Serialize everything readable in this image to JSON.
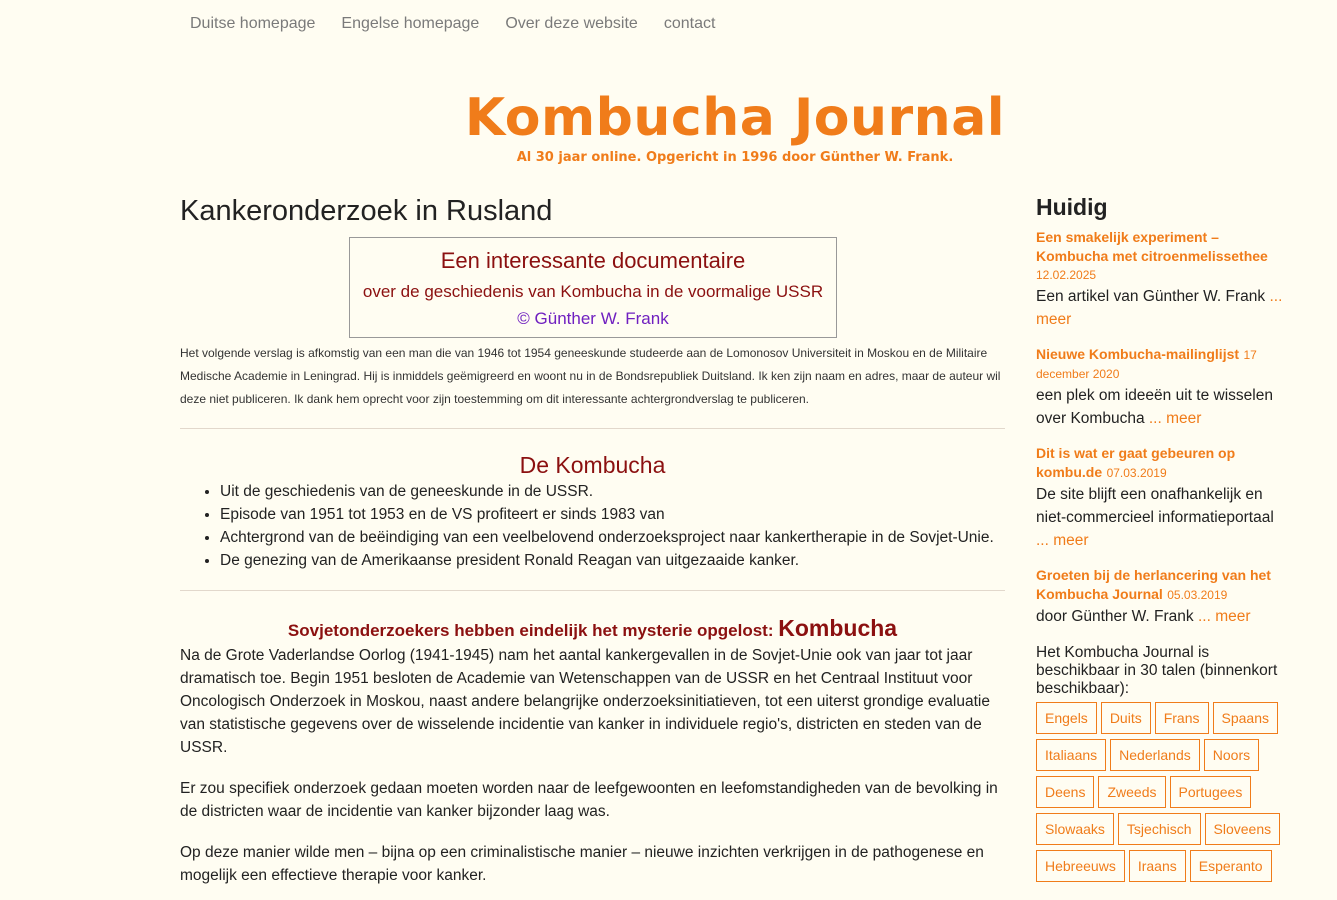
{
  "nav": {
    "items": [
      {
        "label": "Duitse homepage"
      },
      {
        "label": "Engelse homepage"
      },
      {
        "label": "Over deze website"
      },
      {
        "label": "contact"
      }
    ]
  },
  "header": {
    "title": "Kombucha Journal",
    "tagline": "Al 30 jaar online. Opgericht in 1996 door Günther W. Frank."
  },
  "article": {
    "title": "Kankeronderzoek in Rusland",
    "box": {
      "line1": "Een interessante documentaire",
      "line2": "over de geschiedenis van Kombucha in de voormalige USSR",
      "line3": "© Günther W. Frank"
    },
    "intro": "Het volgende verslag is afkomstig van een man die van 1946 tot 1954 geneeskunde studeerde aan de Lomonosov Universiteit in Moskou en de Militaire Medische Academie in Leningrad. Hij is inmiddels geëmigreerd en woont nu in de Bondsrepubliek Duitsland. Ik ken zijn naam en adres, maar de auteur wil deze niet publiceren. Ik dank hem oprecht voor zijn toestemming om dit interessante achtergrondverslag te publiceren.",
    "section1_title": "De Kombucha",
    "points": [
      "Uit de geschiedenis van de geneeskunde in de USSR.",
      "Episode van 1951 tot 1953 en de VS profiteert er sinds 1983 van",
      "Achtergrond van de beëindiging van een veelbelovend onderzoeksproject naar kankertherapie in de Sovjet-Unie.",
      "De genezing van de Amerikaanse president Ronald Reagan van uitgezaaide kanker."
    ],
    "section2_title": "Sovjetonderzoekers hebben eindelijk het mysterie opgelost:",
    "section2_title_bold": "Kombucha",
    "paragraphs": [
      "Na de Grote Vaderlandse Oorlog (1941-1945) nam het aantal kankergevallen in de Sovjet-Unie ook van jaar tot jaar dramatisch toe. Begin 1951 besloten de Academie van Wetenschappen van de USSR en het Centraal Instituut voor Oncologisch Onderzoek in Moskou, naast andere belangrijke onderzoeksinitiatieven, tot een uiterst grondige evaluatie van statistische gegevens over de wisselende incidentie van kanker in individuele regio's, districten en steden van de USSR.",
      "Er zou specifiek onderzoek gedaan moeten worden naar de leefgewoonten en leefomstandigheden van de bevolking in de districten waar de incidentie van kanker bijzonder laag was.",
      "Op deze manier wilde men – bijna op een criminalistische manier – nieuwe inzichten verkrijgen in de pathogenese en mogelijk een effectieve therapie voor kanker."
    ]
  },
  "sidebar": {
    "heading": "Huidig",
    "news": [
      {
        "title": "Een smakelijk experiment – Kombucha met citroenmelissethee",
        "date": "12.02.2025",
        "text": "Een artikel van Günther W. Frank",
        "more": "... meer"
      },
      {
        "title": "Nieuwe Kombucha-mailinglijst",
        "date": "17 december 2020",
        "text": "een plek om ideeën uit te wisselen over Kombucha",
        "more": "... meer"
      },
      {
        "title": "Dit is wat er gaat gebeuren op kombu.de",
        "date": "07.03.2019",
        "text": "De site blijft een onafhankelijk en niet-commercieel informatieportaal",
        "more": "... meer"
      },
      {
        "title": "Groeten bij de herlancering van het Kombucha Journal",
        "date": "05.03.2019",
        "text": "door Günther W. Frank",
        "more": "... meer"
      }
    ],
    "languages_intro": "Het Kombucha Journal is beschikbaar in 30 talen (binnenkort beschikbaar):",
    "languages": [
      "Engels",
      "Duits",
      "Frans",
      "Spaans",
      "Italiaans",
      "Nederlands",
      "Noors",
      "Deens",
      "Zweeds",
      "Portugees",
      "Slowaaks",
      "Tsjechisch",
      "Sloveens",
      "Hebreeuws",
      "Iraans",
      "Esperanto"
    ]
  },
  "colors": {
    "accent": "#f07c1a",
    "heading_red": "#8b1010",
    "copyright_purple": "#7020c0",
    "background": "#fffdf2"
  }
}
